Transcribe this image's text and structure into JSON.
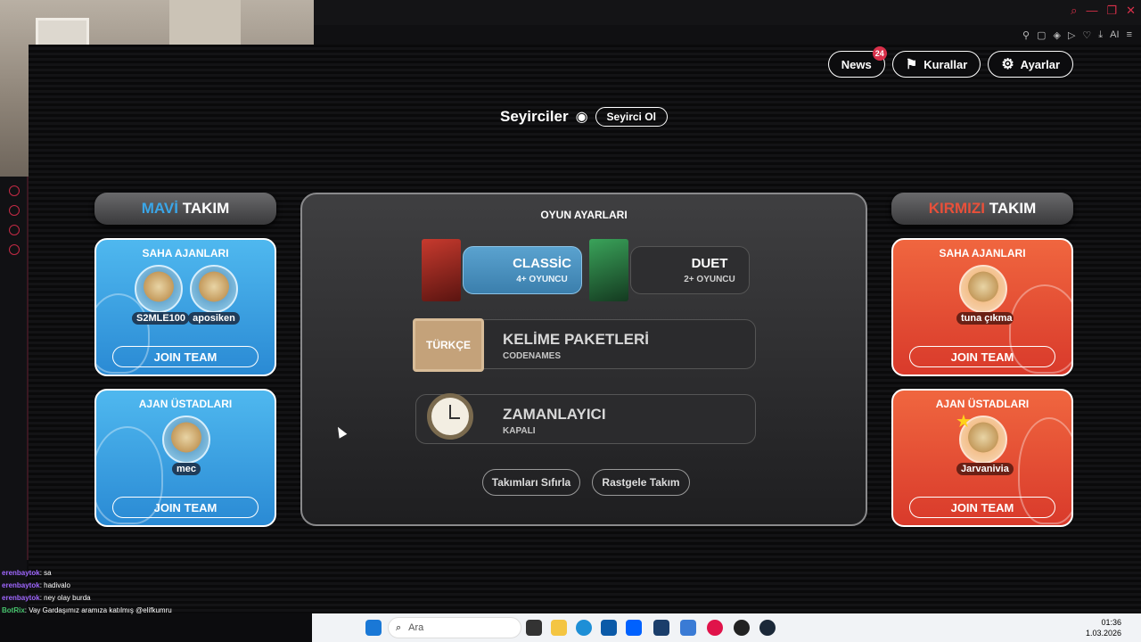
{
  "top_buttons": {
    "news": "News",
    "news_count": "24",
    "rules": "Kurallar",
    "settings": "Ayarlar"
  },
  "spectators": {
    "title": "Seyirciler",
    "button": "Seyirci Ol"
  },
  "blue_team": {
    "name_color": "MAVİ",
    "name": "TAKIM",
    "operatives_title": "SAHA AJANLARI",
    "operatives": [
      "S2MLE100",
      "aposiken"
    ],
    "spymasters_title": "AJAN ÜSTADLARI",
    "spymasters": [
      "mec"
    ],
    "join": "JOIN TEAM"
  },
  "red_team": {
    "name_color": "KIRMIZI",
    "name": "TAKIM",
    "operatives_title": "SAHA AJANLARI",
    "operatives": [
      "tuna çıkma"
    ],
    "spymasters_title": "AJAN ÜSTADLARI",
    "spymasters": [
      "Jarvanivia"
    ],
    "join": "JOIN TEAM"
  },
  "game_settings": {
    "title": "OYUN AYARLARI",
    "modes": [
      {
        "label": "CLASSİC",
        "sub": "4+ OYUNCU",
        "selected": true
      },
      {
        "label": "DUET",
        "sub": "2+ OYUNCU",
        "selected": false
      }
    ],
    "word_pack": {
      "label": "KELİME PAKETLERİ",
      "sub": "CODENAMES",
      "tag": "TÜRKÇE"
    },
    "timer": {
      "label": "ZAMANLAYICI",
      "sub": "KAPALI"
    },
    "reset_teams": "Takımları Sıfırla",
    "random_team": "Rastgele Takım"
  },
  "chat": [
    {
      "user": "erenbaytok",
      "text": ": sa"
    },
    {
      "user": "erenbaytok",
      "text": ": hadivalo"
    },
    {
      "user": "erenbaytok",
      "text": ": ney olay burda"
    },
    {
      "user": "BotRix",
      "text": ": Vay Gardaşımız aramıza katılmış @elifkumru"
    }
  ],
  "taskbar": {
    "search_placeholder": "Ara",
    "time": "01:36",
    "date": "1.03.2026"
  },
  "colors": {
    "blue": "#3aa6e8",
    "red": "#e8503a",
    "accent": "#d9304a"
  }
}
